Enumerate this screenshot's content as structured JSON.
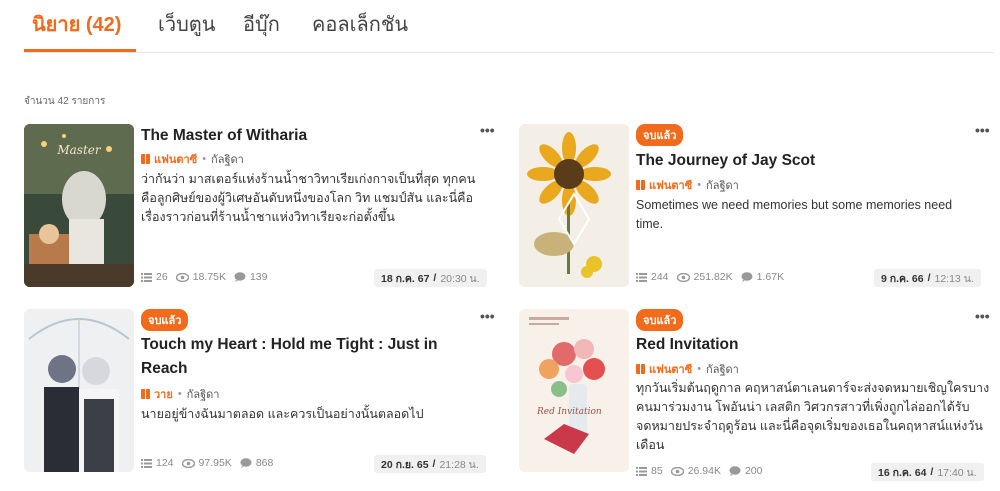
{
  "tabs": [
    {
      "label": "นิยาย (42)",
      "active": true
    },
    {
      "label": "เว็บตูน"
    },
    {
      "label": "อีบุ๊ก"
    },
    {
      "label": "คอลเล็กชัน"
    }
  ],
  "count_text": "จำนวน 42 รายการ",
  "colors": {
    "accent": "#f26b1d"
  },
  "cards": [
    {
      "badge": "",
      "title": "The Master of Witharia",
      "category": "แฟนตาซี",
      "author": "กัลฐิดา",
      "desc": "ว่ากันว่า มาสเตอร์แห่งร้านน้ำชาวิทาเรียเก่งกาจเป็นที่สุด ทุกคนคือลูกศิษย์ของผู้วิเศษอันดับหนึ่งของโลก วิท แชมป์สัน และนี่คือเรื่องราวก่อนที่ร้านน้ำชาแห่งวิทาเรียจะก่อตั้งขึ้น",
      "chapters": "26",
      "views": "18.75K",
      "comments": "139",
      "date": "18 ก.ค. 67",
      "time": "20:30 น.",
      "more": "•••"
    },
    {
      "badge": "จบแล้ว",
      "title": "The Journey of Jay Scot",
      "category": "แฟนตาซี",
      "author": "กัลฐิดา",
      "desc": "Sometimes we need memories but some memories need time.",
      "chapters": "244",
      "views": "251.82K",
      "comments": "1.67K",
      "date": "9 ก.ค. 66",
      "time": "12:13 น.",
      "more": "•••"
    },
    {
      "badge": "จบแล้ว",
      "title": "Touch my Heart : Hold me Tight : Just in Reach",
      "category": "วาย",
      "author": "กัลฐิดา",
      "desc": "นายอยู่ข้างฉันมาตลอด และควรเป็นอย่างนั้นตลอดไป",
      "chapters": "124",
      "views": "97.95K",
      "comments": "868",
      "date": "20 ก.ย. 65",
      "time": "21:28 น.",
      "more": "•••"
    },
    {
      "badge": "จบแล้ว",
      "title": "Red Invitation",
      "category": "แฟนตาซี",
      "author": "กัลฐิดา",
      "desc": "ทุกวันเริ่มต้นฤดูกาล คฤหาสน์ตาเลนดาร์จะส่งจดหมายเชิญใครบางคนมาร่วมงาน โพอันน่า เลสติก วิศวกรสาวที่เพิ่งถูกไล่ออกได้รับจดหมายประจำฤดูร้อน และนี่คือจุดเริ่มของเธอในคฤหาสน์แห่งวันเดือน",
      "chapters": "85",
      "views": "26.94K",
      "comments": "200",
      "date": "16 ก.ค. 64",
      "time": "17:40 น.",
      "more": "•••"
    }
  ]
}
